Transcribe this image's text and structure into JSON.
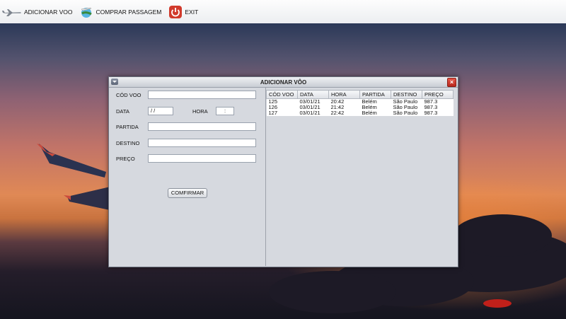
{
  "toolbar": {
    "add_flight_label": "ADICIONAR VOO",
    "buy_ticket_label": "COMPRAR PASSAGEM",
    "exit_label": "EXIT"
  },
  "frame": {
    "title": "ADICIONAR VÔO",
    "form": {
      "cod_voo_label": "CÓD VOO",
      "cod_voo_value": "",
      "data_label": "DATA",
      "data_value": " / /",
      "hora_label": "HORA",
      "hora_value": " :",
      "partida_label": "PARTIDA",
      "partida_value": "",
      "destino_label": "DESTINO",
      "destino_value": "",
      "preco_label": "PREÇO",
      "preco_value": "",
      "confirm_label": "COMFIRMAR"
    },
    "table": {
      "columns": [
        "CÓD VOO",
        "DATA",
        "HORA",
        "PARTIDA",
        "DESTINO",
        "PREÇO"
      ],
      "rows": [
        [
          "125",
          "03/01/21",
          "20:42",
          "Belém",
          "São Paulo",
          "987.3"
        ],
        [
          "126",
          "03/01/21",
          "21:42",
          "Belém",
          "São Paulo",
          "987.3"
        ],
        [
          "127",
          "03/01/21",
          "22:42",
          "Belém",
          "São Paulo",
          "987.3"
        ]
      ]
    }
  },
  "colors": {
    "close_button": "#c8382b",
    "exit_icon": "#d13a2c"
  }
}
